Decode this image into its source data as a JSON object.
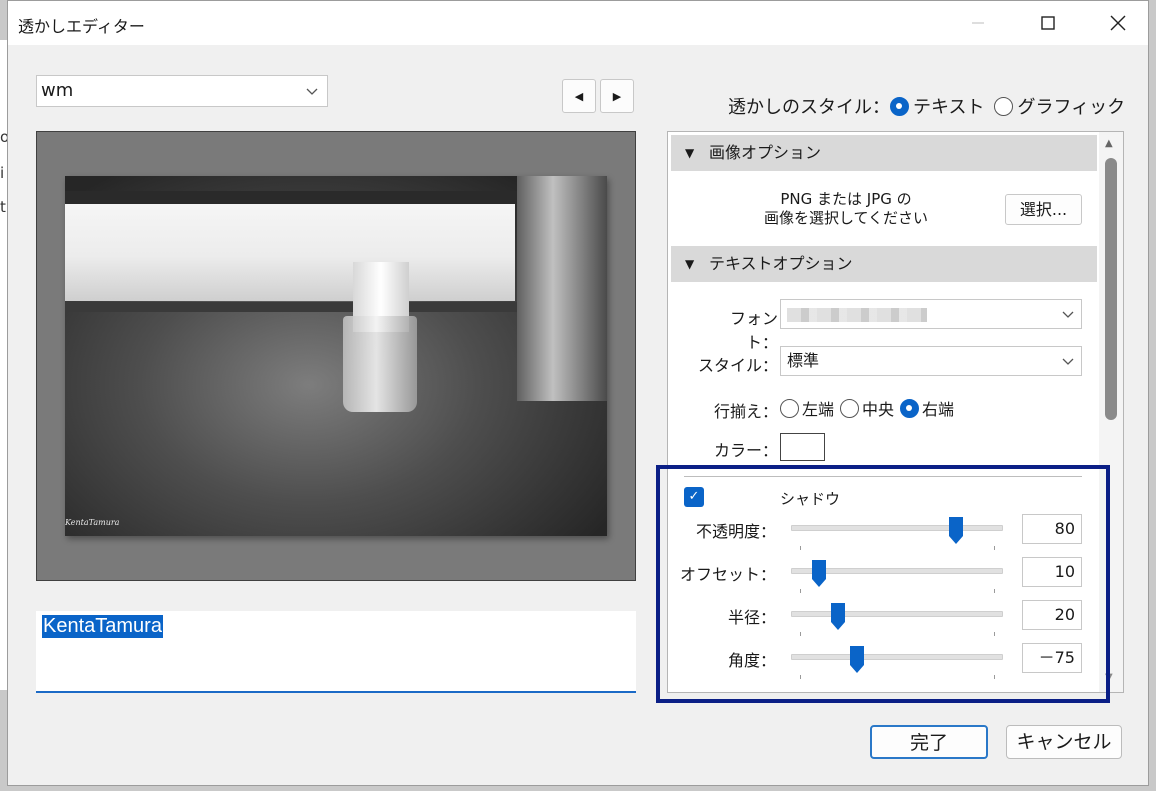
{
  "window": {
    "title": "透かしエディター"
  },
  "background_fragments": [
    "o",
    "i",
    "t"
  ],
  "preset": {
    "value": "wm"
  },
  "nav": {
    "prev": "◀",
    "next": "▶"
  },
  "preview": {
    "photo_signature": "KentaTamura"
  },
  "watermark_text": "KentaTamura",
  "style_selector": {
    "label": "透かしのスタイル：",
    "options": [
      {
        "label": "テキスト",
        "selected": true
      },
      {
        "label": "グラフィック",
        "selected": false
      }
    ]
  },
  "image_options": {
    "header": "画像オプション",
    "hint_line1": "PNG または JPG の",
    "hint_line2": "画像を選択してください",
    "select_button": "選択..."
  },
  "text_options": {
    "header": "テキストオプション",
    "font_label": "フォント：",
    "style_label": "スタイル：",
    "style_value": "標準",
    "align_label": "行揃え：",
    "align_options": [
      {
        "label": "左端",
        "selected": false
      },
      {
        "label": "中央",
        "selected": false
      },
      {
        "label": "右端",
        "selected": true
      }
    ],
    "color_label": "カラー："
  },
  "shadow": {
    "enabled": true,
    "label": "シャドウ",
    "sliders": [
      {
        "label": "不透明度：",
        "value": "80",
        "position": 0.78
      },
      {
        "label": "オフセット：",
        "value": "10",
        "position": 0.13
      },
      {
        "label": "半径：",
        "value": "20",
        "position": 0.22
      },
      {
        "label": "角度：",
        "value": "－75",
        "position": 0.31
      }
    ]
  },
  "buttons": {
    "done": "完了",
    "cancel": "キャンセル"
  },
  "colors": {
    "accent": "#0a64c8",
    "highlight_frame": "#0b1f86"
  }
}
